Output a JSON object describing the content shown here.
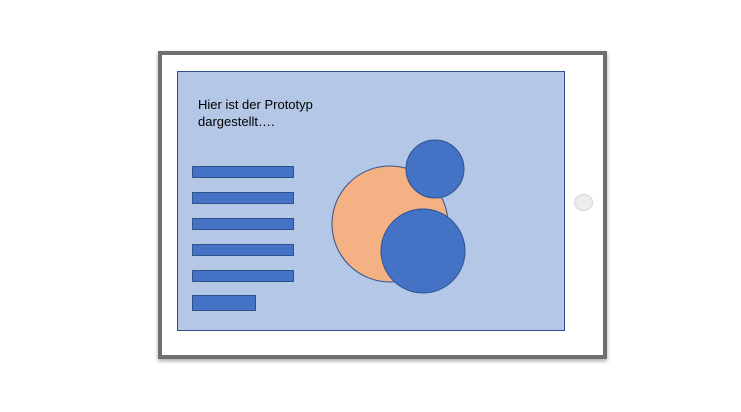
{
  "caption": {
    "line1": "Hier ist der Prototyp",
    "line2": "dargestellt…."
  },
  "colors": {
    "screen_bg": "#b4c7e7",
    "bar_fill": "#4472c4",
    "circle_orange": "#f4b183",
    "circle_blue": "#4472c4",
    "frame": "#706e6f"
  },
  "icons": {
    "home_button": "home-button-icon"
  }
}
